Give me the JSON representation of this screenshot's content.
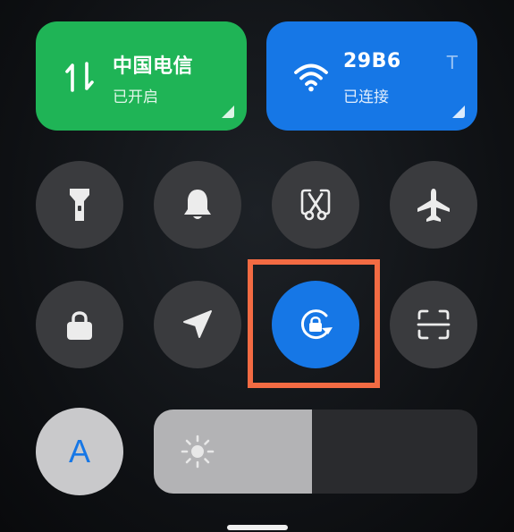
{
  "tiles": {
    "mobile_data": {
      "title": "中国电信",
      "status": "已开启",
      "color": "#1fb456",
      "icon": "data-transfer-icon"
    },
    "wifi": {
      "title": "29B6",
      "extra": "T",
      "status": "已连接",
      "color": "#1677e6",
      "icon": "wifi-icon"
    }
  },
  "toggles": [
    {
      "name": "flashlight",
      "icon": "flashlight-icon",
      "active": false
    },
    {
      "name": "silent",
      "icon": "bell-icon",
      "active": false
    },
    {
      "name": "screenshot",
      "icon": "scissors-screenshot-icon",
      "active": false
    },
    {
      "name": "airplane",
      "icon": "airplane-icon",
      "active": false
    },
    {
      "name": "lock-screen",
      "icon": "lock-icon",
      "active": false
    },
    {
      "name": "location",
      "icon": "location-arrow-icon",
      "active": false
    },
    {
      "name": "rotation-lock",
      "icon": "rotation-lock-icon",
      "active": true
    },
    {
      "name": "scanner",
      "icon": "scan-frame-icon",
      "active": false
    }
  ],
  "auto_brightness": {
    "label": "A",
    "icon": "auto-brightness-icon"
  },
  "brightness": {
    "level": 0.49,
    "icon": "sun-icon"
  },
  "colors": {
    "active": "#1677e6",
    "inactive": "#3a3b3e",
    "highlight": "#f36b43"
  }
}
